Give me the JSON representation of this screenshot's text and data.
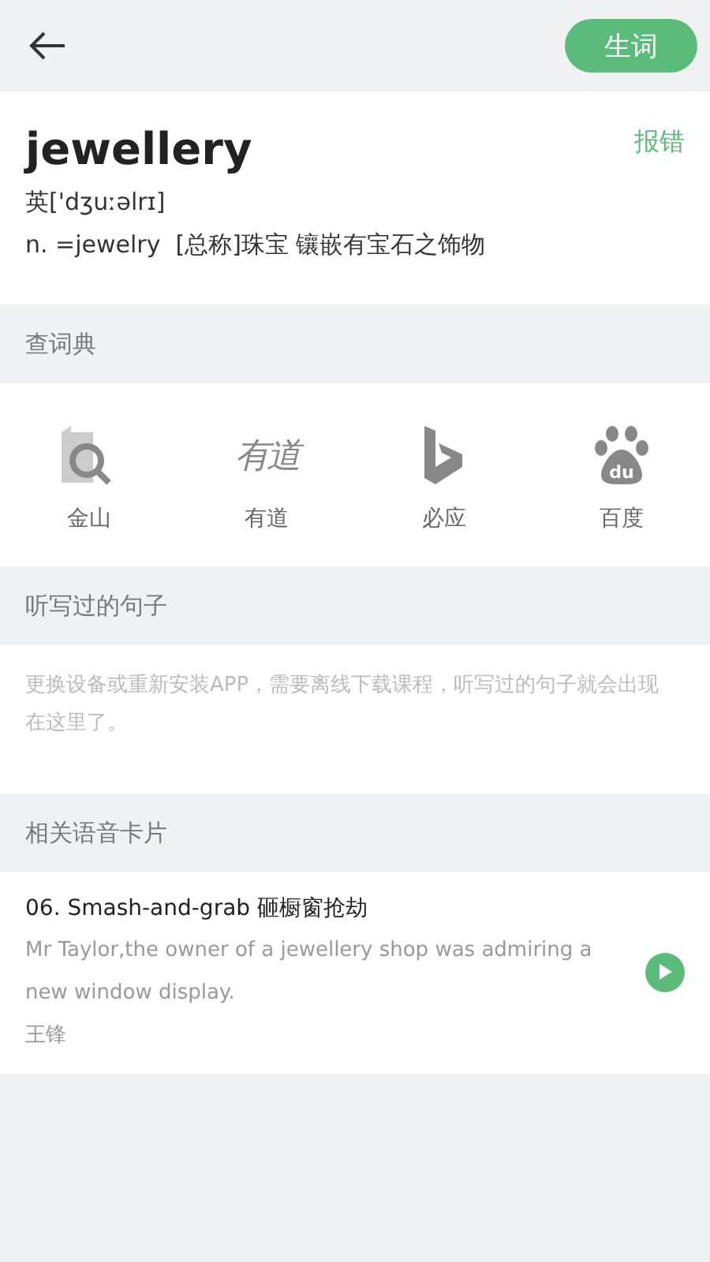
{
  "header": {
    "action": "生词"
  },
  "word": {
    "headword": "jewellery",
    "report": "报错",
    "phonetic": "英['dʒuːəlrɪ]",
    "definition": "n. =jewelry  [总称]珠宝 镶嵌有宝石之饰物"
  },
  "dictionary_section": {
    "title": "查词典",
    "items": [
      {
        "kind": "kingsoft",
        "label": "金山"
      },
      {
        "kind": "youdao",
        "label": "有道",
        "logo_text": "有道"
      },
      {
        "kind": "bing",
        "label": "必应"
      },
      {
        "kind": "baidu",
        "label": "百度",
        "logo_text": "du"
      }
    ]
  },
  "dictation_section": {
    "title": "听写过的句子",
    "message": "更换设备或重新安装APP，需要离线下载课程，听写过的句子就会出现在这里了。"
  },
  "cards_section": {
    "title": "相关语音卡片",
    "cards": [
      {
        "title": "06. Smash-and-grab 砸橱窗抢劫",
        "sentence": "Mr Taylor,the owner of a jewellery shop was admiring a new window display.",
        "author": "王锋"
      }
    ]
  }
}
